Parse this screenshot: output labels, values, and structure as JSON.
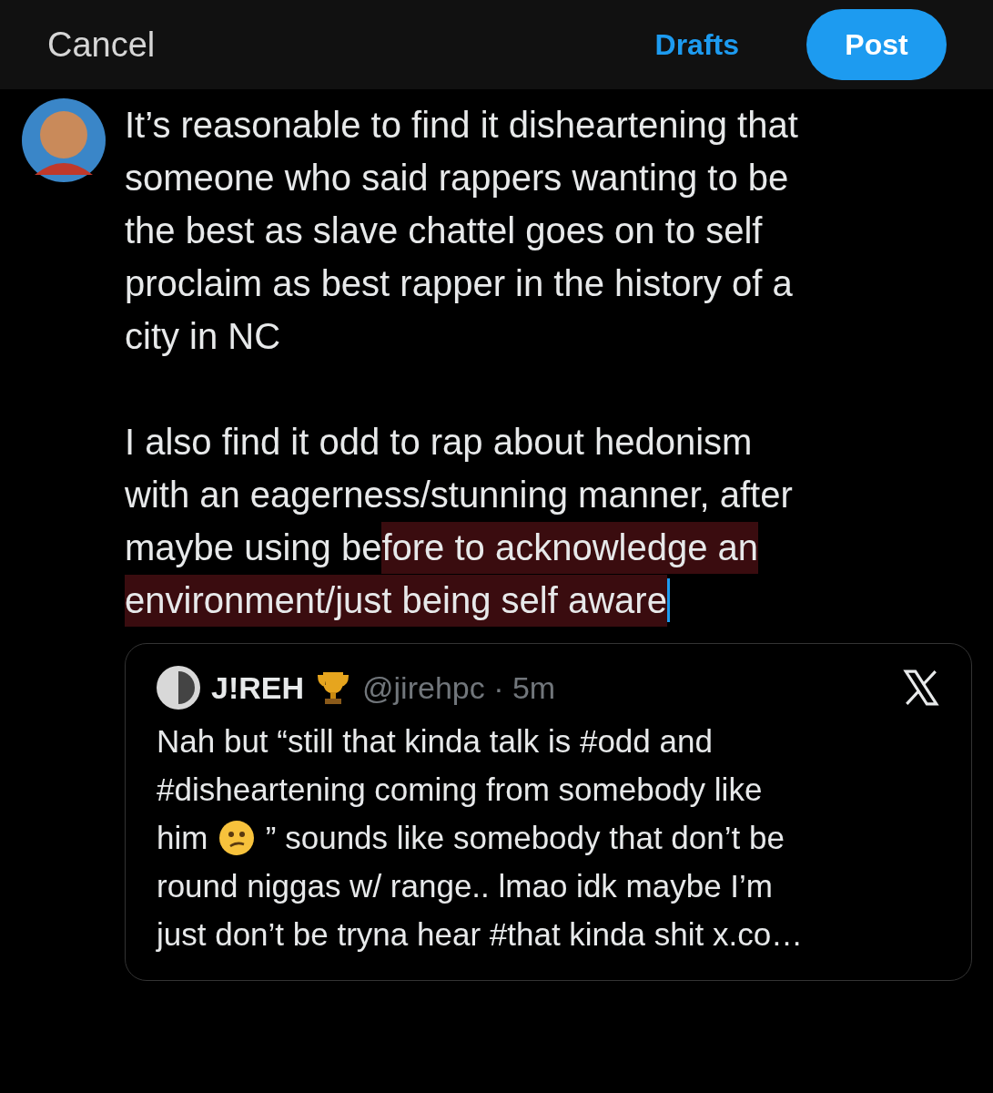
{
  "header": {
    "cancel": "Cancel",
    "drafts": "Drafts",
    "post": "Post"
  },
  "compose": {
    "paragraphs": [
      [
        [
          {
            "text": "It’s reasonable to find it disheartening that",
            "selected": false
          }
        ],
        [
          {
            "text": "someone who said rappers wanting to be",
            "selected": false
          }
        ],
        [
          {
            "text": "the best as slave chattel goes on to self",
            "selected": false
          }
        ],
        [
          {
            "text": "proclaim as best rapper in the history of a",
            "selected": false
          }
        ],
        [
          {
            "text": "city in NC",
            "selected": false
          }
        ]
      ],
      [
        [
          {
            "text": "I also find it odd to rap about hedonism",
            "selected": false
          }
        ],
        [
          {
            "text": "with an eagerness/stunning manner, after",
            "selected": false
          }
        ],
        [
          {
            "text": "maybe using be",
            "selected": false
          },
          {
            "text": "fore to acknowledge an",
            "selected": true
          }
        ],
        [
          {
            "text": "environment/just being self aware",
            "selected": true
          }
        ]
      ]
    ]
  },
  "quote": {
    "name": "J!REH",
    "handle": "@jirehpc · 5m",
    "lines": [
      [
        {
          "kind": "text",
          "text": "Nah but “still that kinda talk is #odd and"
        }
      ],
      [
        {
          "kind": "text",
          "text": "#disheartening coming from somebody like"
        }
      ],
      [
        {
          "kind": "text",
          "text": "him "
        },
        {
          "kind": "emoji"
        },
        {
          "kind": "text",
          "text": " ” sounds like somebody that don’t be"
        }
      ],
      [
        {
          "kind": "text",
          "text": "round niggas w/ range.. lmao idk maybe I’m"
        }
      ],
      [
        {
          "kind": "text",
          "text": "just don’t be tryna hear #that kinda shit x.co…"
        }
      ]
    ]
  }
}
